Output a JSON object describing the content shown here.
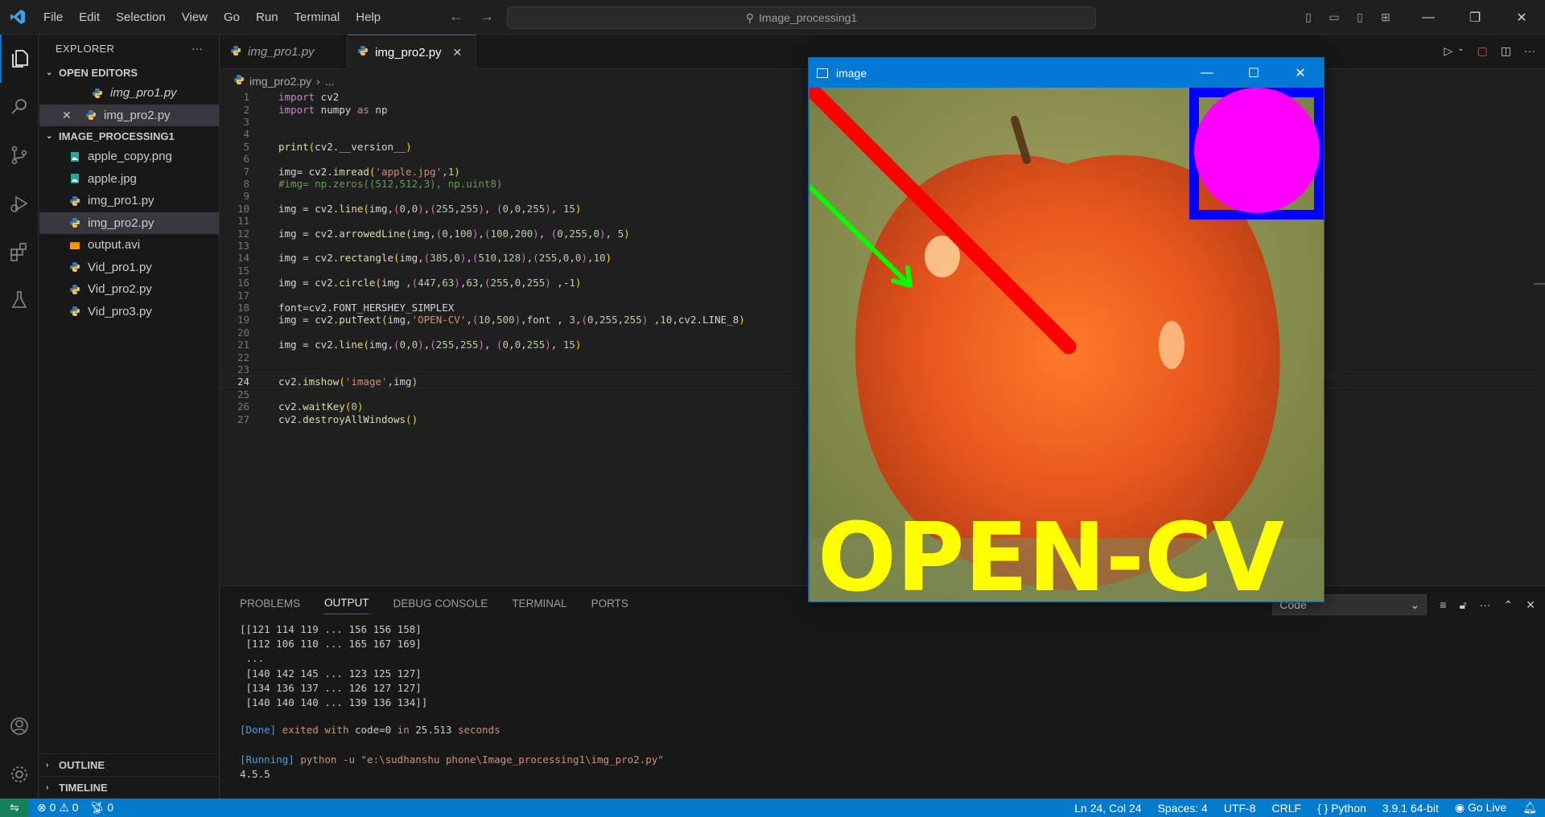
{
  "titlebar": {
    "menu": [
      "File",
      "Edit",
      "Selection",
      "View",
      "Go",
      "Run",
      "Terminal",
      "Help"
    ],
    "search": "Image_processing1"
  },
  "sidebar": {
    "title": "EXPLORER",
    "open_editors_label": "OPEN EDITORS",
    "open_editors": [
      {
        "name": "img_pro1.py",
        "icon": "python-icon"
      },
      {
        "name": "img_pro2.py",
        "icon": "python-icon"
      }
    ],
    "folder_label": "IMAGE_PROCESSING1",
    "files": [
      {
        "name": "apple_copy.png",
        "icon": "image-icon"
      },
      {
        "name": "apple.jpg",
        "icon": "image-icon"
      },
      {
        "name": "img_pro1.py",
        "icon": "python-icon"
      },
      {
        "name": "img_pro2.py",
        "icon": "python-icon"
      },
      {
        "name": "output.avi",
        "icon": "video-icon"
      },
      {
        "name": "Vid_pro1.py",
        "icon": "python-icon"
      },
      {
        "name": "Vid_pro2.py",
        "icon": "python-icon"
      },
      {
        "name": "Vid_pro3.py",
        "icon": "python-icon"
      }
    ],
    "outline_label": "OUTLINE",
    "timeline_label": "TIMELINE"
  },
  "tabs": [
    {
      "label": "img_pro1.py",
      "active": false
    },
    {
      "label": "img_pro2.py",
      "active": true
    }
  ],
  "breadcrumb": {
    "file": "img_pro2.py",
    "rest": "..."
  },
  "editor": {
    "current_line": 24,
    "lines": [
      "import cv2",
      "import numpy as np",
      "",
      "",
      "print(cv2.__version__)",
      "",
      "img= cv2.imread('apple.jpg',1)",
      "#img= np.zeros((512,512,3), np.uint8)",
      "",
      "img = cv2.line(img,(0,0),(255,255), (0,0,255), 15)",
      "",
      "img = cv2.arrowedLine(img,(0,100),(100,200), (0,255,0), 5)",
      "",
      "img = cv2.rectangle(img,(385,0),(510,128),(255,0,0),10)",
      "",
      "img = cv2.circle(img ,(447,63),63,(255,0,255) ,-1)",
      "",
      "font=cv2.FONT_HERSHEY_SIMPLEX",
      "img = cv2.putText(img,'OPEN-CV',(10,500),font , 3,(0,255,255) ,10,cv2.LINE_8)",
      "",
      "img = cv2.line(img,(0,0),(255,255), (0,0,255), 15)",
      "",
      "",
      "cv2.imshow('image',img)",
      "",
      "cv2.waitKey(0)",
      "cv2.destroyAllWindows()"
    ]
  },
  "panel": {
    "tabs": [
      "PROBLEMS",
      "OUTPUT",
      "DEBUG CONSOLE",
      "TERMINAL",
      "PORTS"
    ],
    "active_tab": "OUTPUT",
    "select_value": "Code",
    "output_lines": [
      "[[121 114 119 ... 156 156 158]",
      " [112 106 110 ... 165 167 169]",
      " ...",
      " [140 142 145 ... 123 125 127]",
      " [134 136 137 ... 126 127 127]",
      " [140 140 140 ... 139 136 134]]"
    ],
    "done_tag": "[Done]",
    "done_text": " exited with ",
    "done_code": "code=0",
    "done_in": " in ",
    "done_time": "25.513",
    "done_unit": " seconds",
    "run_tag": "[Running]",
    "run_cmd": " python -u ",
    "run_path": "\"e:\\sudhanshu phone\\Image_processing1\\img_pro2.py\"",
    "version": "4.5.5"
  },
  "image_window": {
    "title": "image",
    "overlay_text": "OPEN-CV",
    "colors": {
      "line": "#ff0000",
      "arrow": "#00ff00",
      "rect": "#0000ff",
      "circle": "#ff00ff",
      "text": "#ffff00"
    }
  },
  "statusbar": {
    "errors": "0",
    "warnings": "0",
    "ports": "0",
    "position": "Ln 24, Col 24",
    "spaces": "Spaces: 4",
    "encoding": "UTF-8",
    "eol": "CRLF",
    "language": "Python",
    "interpreter": "3.9.1 64-bit",
    "golive": "Go Live"
  }
}
